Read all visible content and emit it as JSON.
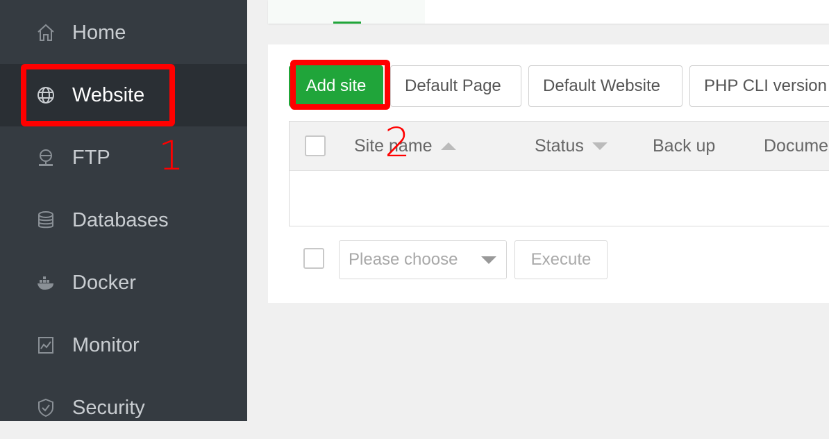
{
  "sidebar": {
    "items": [
      {
        "label": "Home",
        "icon": "home-icon"
      },
      {
        "label": "Website",
        "icon": "globe-icon",
        "active": true
      },
      {
        "label": "FTP",
        "icon": "ftp-icon"
      },
      {
        "label": "Databases",
        "icon": "database-icon"
      },
      {
        "label": "Docker",
        "icon": "docker-icon"
      },
      {
        "label": "Monitor",
        "icon": "monitor-icon"
      },
      {
        "label": "Security",
        "icon": "shield-icon"
      }
    ]
  },
  "toolbar": {
    "add_site": "Add site",
    "default_page": "Default Page",
    "default_website": "Default Website",
    "php_cli": "PHP CLI version"
  },
  "table": {
    "columns": [
      {
        "label": "Site name",
        "sort": "asc"
      },
      {
        "label": "Status",
        "sort": "desc"
      },
      {
        "label": "Back up"
      },
      {
        "label": "Document"
      }
    ]
  },
  "batch": {
    "select_placeholder": "Please choose",
    "execute_label": "Execute"
  },
  "annotations": {
    "step1": "1",
    "step2": "2"
  },
  "colors": {
    "sidebar_bg": "#353b41",
    "sidebar_active_bg": "#2a2f34",
    "accent_green": "#20a53a",
    "annotation_red": "#ff0000"
  }
}
